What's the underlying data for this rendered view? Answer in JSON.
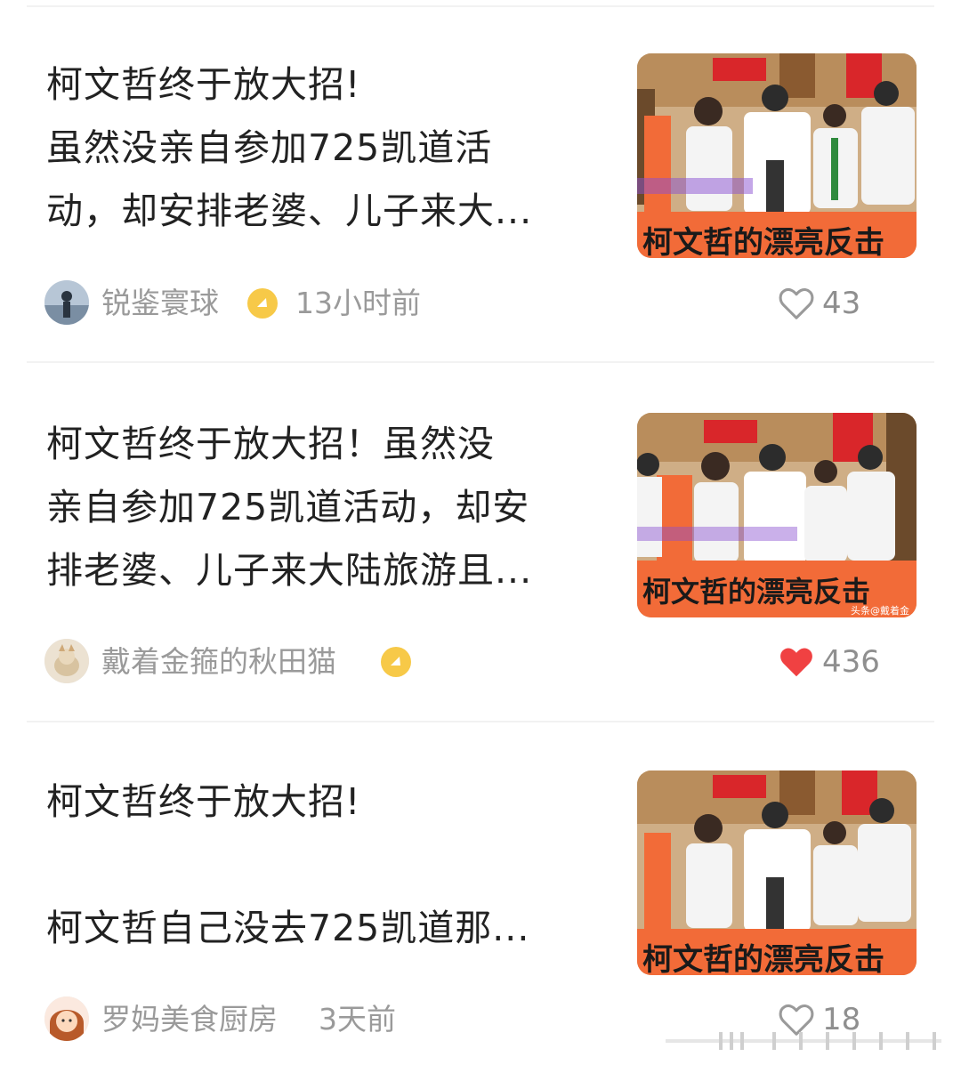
{
  "feed": {
    "items": [
      {
        "title": "柯文哲终于放大招!\n虽然没亲自参加725凯道活\n动，却安排老婆、儿子来大...",
        "author": "锐鉴寰球",
        "verified": true,
        "time": "13小时前",
        "likes": "43",
        "liked": false,
        "thumb_caption": "柯文哲的漂亮反击"
      },
      {
        "title": "柯文哲终于放大招！虽然没\n亲自参加725凯道活动，却安\n排老婆、儿子来大陆旅游且...",
        "author": "戴着金箍的秋田猫",
        "verified": true,
        "time": "",
        "likes": "436",
        "liked": true,
        "thumb_caption": "柯文哲的漂亮反击",
        "thumb_watermark": "头条@戴着金"
      },
      {
        "title": "柯文哲终于放大招!\n\n柯文哲自己没去725凯道那...",
        "author": "罗妈美食厨房",
        "verified": false,
        "time": "3天前",
        "likes": "18",
        "liked": false,
        "thumb_caption": "柯文哲的漂亮反击"
      }
    ]
  },
  "colors": {
    "accent_like": "#f04142",
    "thumb_banner": "#f26b38",
    "badge": "#f7c948"
  },
  "icons": [
    "heart-outline-icon",
    "heart-filled-icon",
    "verified-badge-icon"
  ]
}
